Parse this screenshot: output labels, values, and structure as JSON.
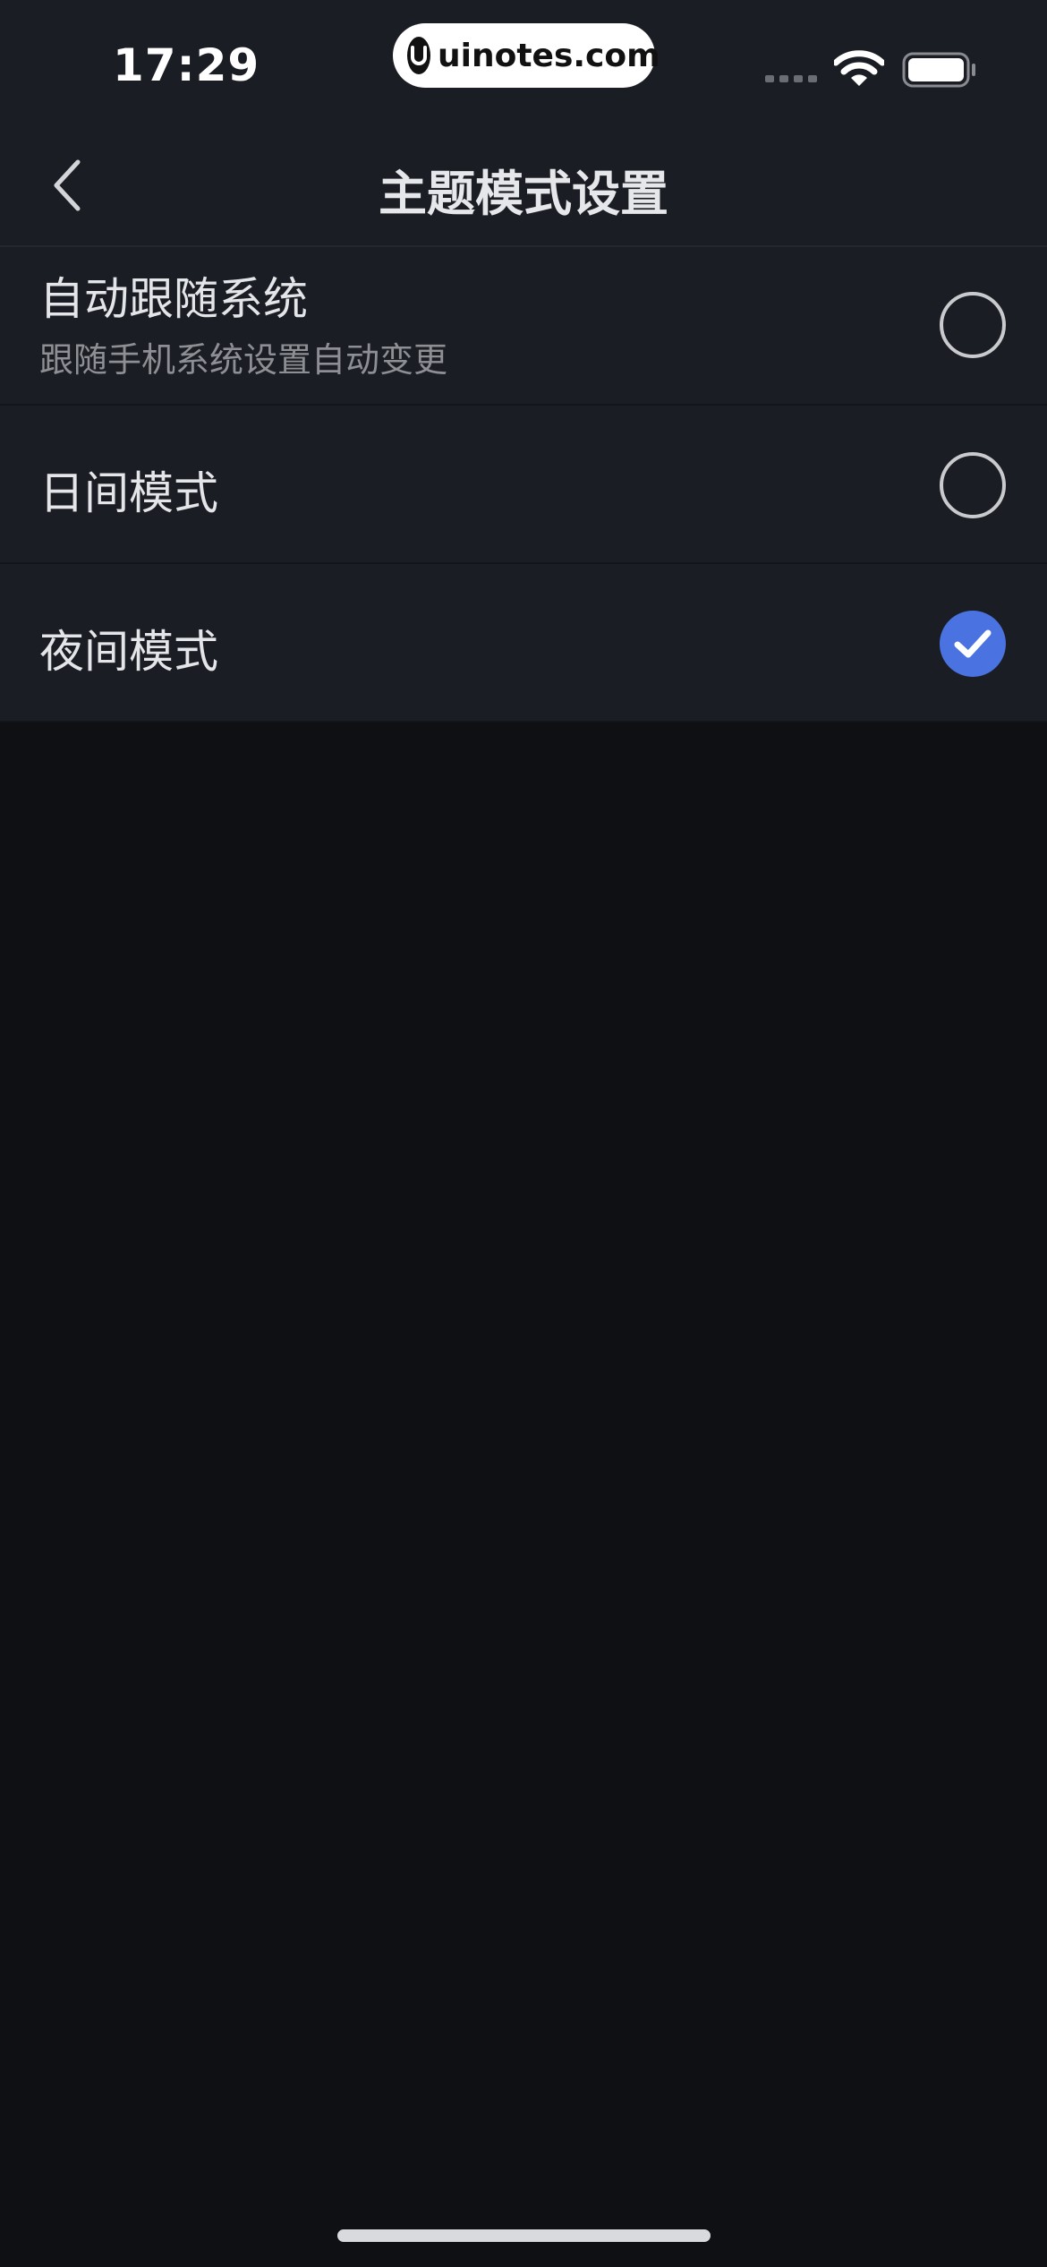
{
  "status_bar": {
    "time": "17:29",
    "watermark": "uinotes.com",
    "watermark_logo_letter": "U"
  },
  "nav": {
    "title": "主题模式设置"
  },
  "options": [
    {
      "title": "自动跟随系统",
      "subtitle": "跟随手机系统设置自动变更",
      "selected": false
    },
    {
      "title": "日间模式",
      "selected": false
    },
    {
      "title": "夜间模式",
      "selected": true
    }
  ],
  "colors": {
    "background": "#0f1014",
    "surface": "#1b1d24",
    "accent": "#4a72e0",
    "text_primary": "#e4e5e8",
    "text_secondary": "#8d8f95"
  },
  "icons": {
    "back": "chevron-left-icon",
    "wifi": "wifi-icon",
    "battery": "battery-icon",
    "signal": "cellular-signal-icon",
    "check": "checkmark-icon"
  }
}
